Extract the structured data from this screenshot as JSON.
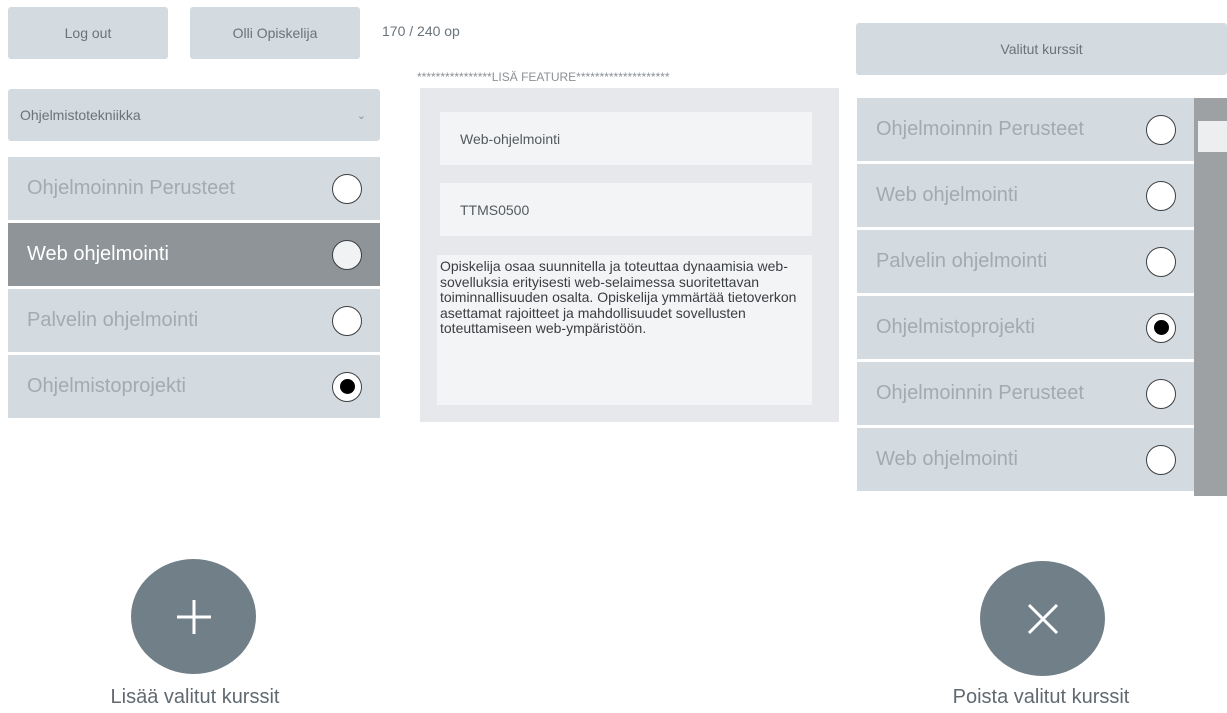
{
  "header": {
    "logout_label": "Log out",
    "user_label": "Olli Opiskelija",
    "credits": "170 / 240 op",
    "selected_courses_label": "Valitut kurssit"
  },
  "program_select": {
    "selected": "Ohjelmistotekniikka"
  },
  "course_list": [
    {
      "name": "Ohjelmoinnin Perusteet",
      "checked": false,
      "selected": false
    },
    {
      "name": "Web ohjelmointi",
      "checked": false,
      "selected": true
    },
    {
      "name": "Palvelin ohjelmointi",
      "checked": false,
      "selected": false
    },
    {
      "name": "Ohjelmistoprojekti",
      "checked": true,
      "selected": false
    }
  ],
  "detail": {
    "header": "****************LISÄ FEATURE********************",
    "course_name": "Web-ohjelmointi",
    "course_code": "TTMS0500",
    "description": "Opiskelija osaa suunnitella ja toteuttaa dynaamisia web-sovelluksia erityisesti web-selaimessa suoritettavan toiminnallisuuden osalta. Opiskelija ymmärtää tietoverkon asettamat rajoitteet ja mahdollisuudet sovellusten toteuttamiseen web-ympäristöön."
  },
  "selected_list": [
    {
      "name": "Ohjelmoinnin Perusteet",
      "checked": false
    },
    {
      "name": "Web ohjelmointi",
      "checked": false
    },
    {
      "name": "Palvelin ohjelmointi",
      "checked": false
    },
    {
      "name": "Ohjelmistoprojekti",
      "checked": true
    },
    {
      "name": "Ohjelmoinnin Perusteet",
      "checked": false
    },
    {
      "name": "Web ohjelmointi",
      "checked": false
    }
  ],
  "actions": {
    "add_label": "Lisää valitut kurssit",
    "add_icon": "plus-icon",
    "remove_label": "Poista valitut kurssit",
    "remove_icon": "close-icon"
  },
  "colors": {
    "panel": "#d3dbe0",
    "selected_row": "#8e9498",
    "action_button": "#718088"
  }
}
